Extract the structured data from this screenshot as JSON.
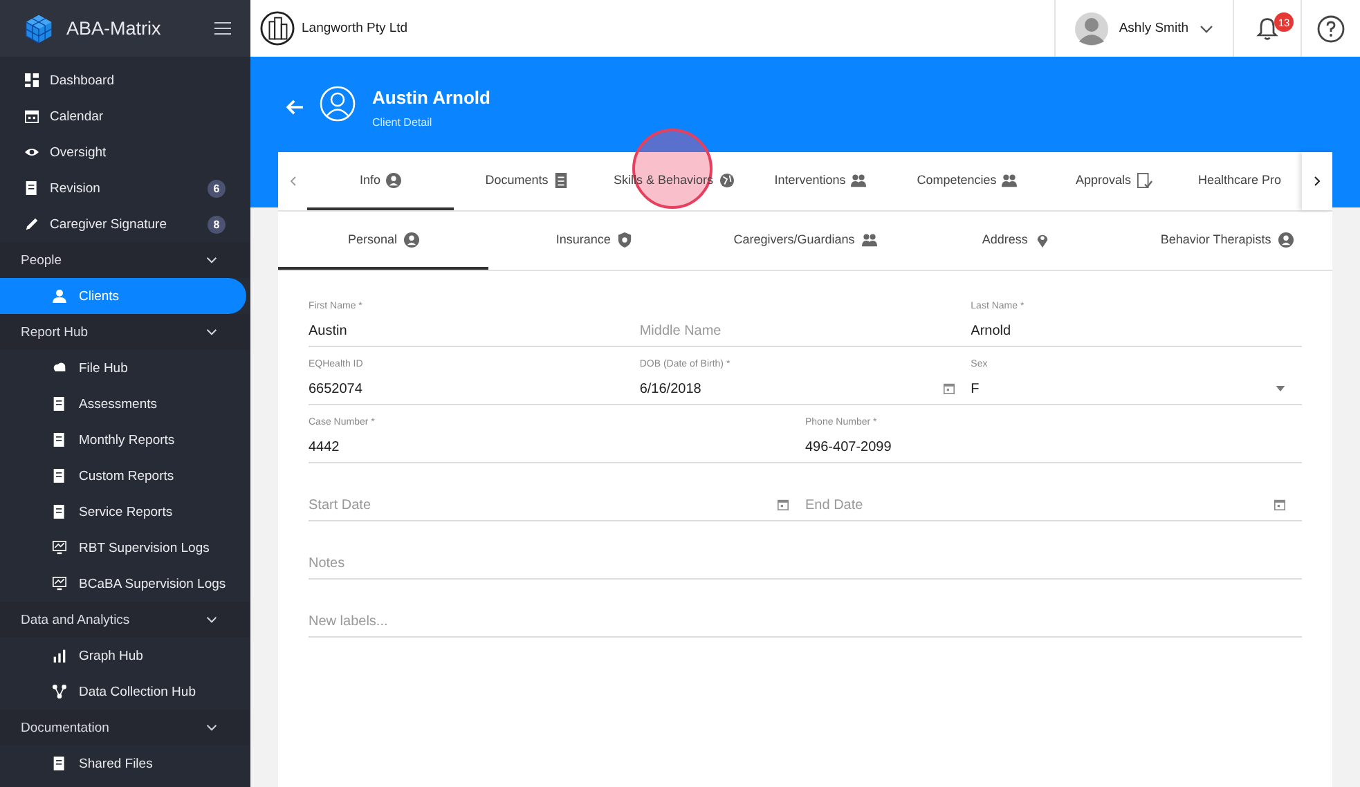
{
  "sidebar": {
    "brand": "ABA-Matrix",
    "items": [
      {
        "kind": "link",
        "label": "Dashboard",
        "selected": false
      },
      {
        "kind": "link",
        "label": "Calendar",
        "selected": false
      },
      {
        "kind": "link",
        "label": "Oversight",
        "selected": false
      },
      {
        "kind": "link",
        "label": "Revision",
        "badge": "6",
        "selected": false
      },
      {
        "kind": "link",
        "label": "Caregiver Signature",
        "badge": "8",
        "selected": false
      },
      {
        "kind": "section",
        "label": "People",
        "expanded": true,
        "children": [
          {
            "label": "Clients",
            "selected": true
          }
        ]
      },
      {
        "kind": "section",
        "label": "Report Hub",
        "expanded": true,
        "children": [
          {
            "label": "File Hub",
            "selected": false
          },
          {
            "label": "Assessments",
            "selected": false
          },
          {
            "label": "Monthly Reports",
            "selected": false
          },
          {
            "label": "Custom Reports",
            "selected": false
          },
          {
            "label": "Service Reports",
            "selected": false
          },
          {
            "label": "RBT Supervision Logs",
            "selected": false
          },
          {
            "label": "BCaBA Supervision Logs",
            "selected": false
          }
        ]
      },
      {
        "kind": "section",
        "label": "Data and Analytics",
        "expanded": true,
        "children": [
          {
            "label": "Graph Hub",
            "selected": false
          },
          {
            "label": "Data Collection Hub",
            "selected": false
          }
        ]
      },
      {
        "kind": "section",
        "label": "Documentation",
        "expanded": true,
        "children": [
          {
            "label": "Shared Files",
            "selected": false
          }
        ]
      }
    ]
  },
  "top_bar": {
    "company": "Langworth Pty Ltd",
    "user": "Ashly Smith",
    "notifications": "13"
  },
  "header": {
    "name": "Austin Arnold",
    "subtitle": "Client Detail"
  },
  "tabs": [
    {
      "label": "Info",
      "selected": true
    },
    {
      "label": "Documents",
      "selected": false
    },
    {
      "label": "Skills & Behaviors",
      "selected": false
    },
    {
      "label": "Interventions",
      "selected": false
    },
    {
      "label": "Competencies",
      "selected": false
    },
    {
      "label": "Approvals",
      "selected": false
    },
    {
      "label": "Healthcare Pro",
      "selected": false
    }
  ],
  "subtabs": [
    {
      "label": "Personal",
      "selected": true
    },
    {
      "label": "Insurance",
      "selected": false
    },
    {
      "label": "Caregivers/Guardians",
      "selected": false
    },
    {
      "label": "Address",
      "selected": false
    },
    {
      "label": "Behavior Therapists",
      "selected": false
    }
  ],
  "form": {
    "rows": [
      [
        {
          "kind": "text",
          "label": "First Name *",
          "value": "Austin"
        },
        {
          "kind": "text",
          "placeholder": "Middle Name"
        },
        {
          "kind": "text",
          "label": "Last Name *",
          "value": "Arnold"
        }
      ],
      [
        {
          "kind": "text",
          "label": "EQHealth ID",
          "value": "6652074"
        },
        {
          "kind": "date",
          "label": "DOB (Date of Birth) *",
          "value": "6/16/2018"
        },
        {
          "kind": "select",
          "label": "Sex",
          "value": "F"
        }
      ],
      [
        {
          "kind": "text",
          "label": "Case Number *",
          "value": "4442"
        },
        {
          "kind": "text",
          "label": "Phone Number *",
          "value": "496-407-2099"
        }
      ],
      [
        {
          "kind": "date",
          "placeholder": "Start Date"
        },
        {
          "kind": "date",
          "placeholder": "End Date"
        }
      ],
      [
        {
          "kind": "text",
          "placeholder": "Notes"
        }
      ],
      [
        {
          "kind": "text",
          "placeholder": "New labels..."
        }
      ]
    ]
  },
  "click_marker": {
    "shown": true
  }
}
